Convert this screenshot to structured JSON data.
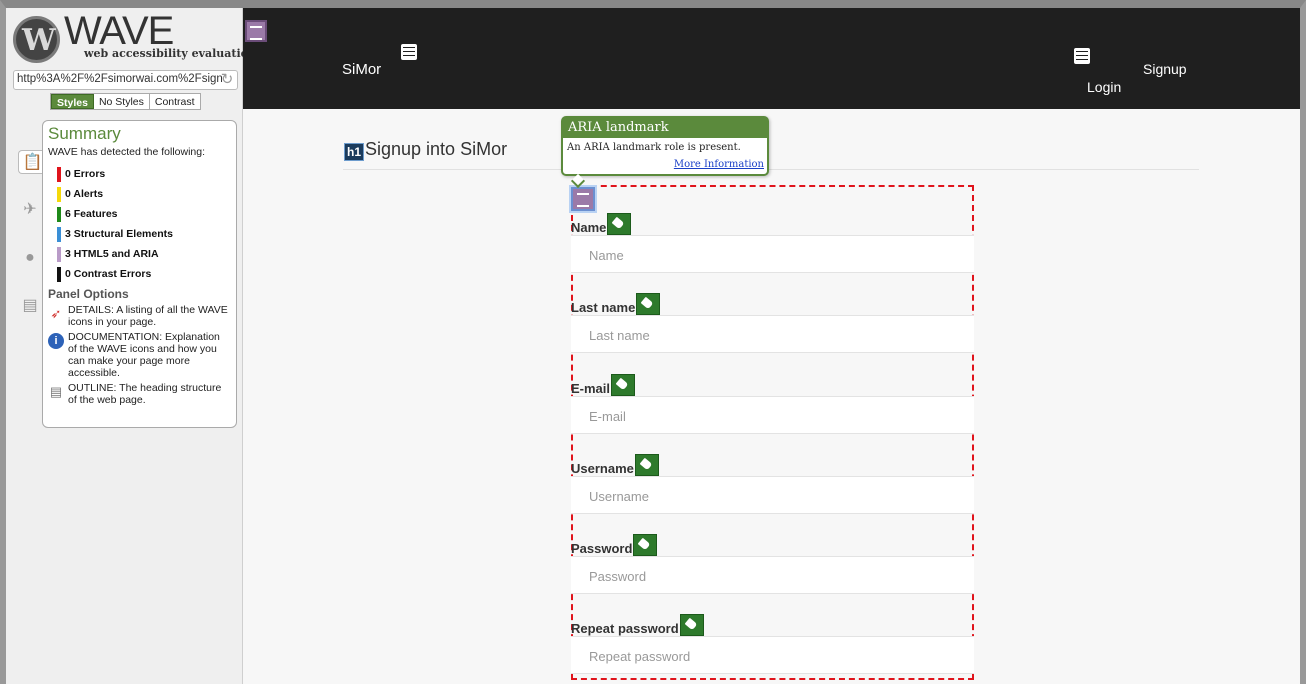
{
  "wave": {
    "wordmark": "WAVE",
    "tagline": "web accessibility evaluation tool",
    "url": "http%3A%2F%2Fsimorwai.com%2Fsign",
    "tabs": [
      "Styles",
      "No Styles",
      "Contrast"
    ],
    "active_tab": "Styles",
    "summary": {
      "title": "Summary",
      "intro": "WAVE has detected the following:",
      "items": [
        {
          "label": "0 Errors",
          "color": "#e0141c"
        },
        {
          "label": "0 Alerts",
          "color": "#f5d90a"
        },
        {
          "label": "6 Features",
          "color": "#1f8a1a"
        },
        {
          "label": "3 Structural Elements",
          "color": "#3a8fd6"
        },
        {
          "label": "3 HTML5 and ARIA",
          "color": "#b99bc8"
        },
        {
          "label": "0 Contrast Errors",
          "color": "#111111"
        }
      ],
      "panel_options_title": "Panel Options",
      "options": [
        {
          "icon": "flag-icon",
          "text": "DETAILS: A listing of all the WAVE icons in your page."
        },
        {
          "icon": "info-icon",
          "text": "DOCUMENTATION: Explanation of the WAVE icons and how you can make your page more accessible."
        },
        {
          "icon": "outline-doc-icon",
          "text": "OUTLINE: The heading structure of the web page."
        }
      ]
    }
  },
  "site": {
    "brand": "SiMor",
    "nav": {
      "login": "Login",
      "signup": "Signup"
    },
    "h1_badge": "h1",
    "title": "Signup into SiMor"
  },
  "tooltip": {
    "title": "ARIA landmark",
    "body": "An ARIA landmark role is present.",
    "link": "More Information"
  },
  "form": {
    "fields": [
      {
        "label": "Name",
        "placeholder": "Name"
      },
      {
        "label": "Last name",
        "placeholder": "Last name"
      },
      {
        "label": "E-mail",
        "placeholder": "E-mail"
      },
      {
        "label": "Username",
        "placeholder": "Username"
      },
      {
        "label": "Password",
        "placeholder": "Password"
      },
      {
        "label": "Repeat password",
        "placeholder": "Repeat password"
      }
    ]
  }
}
